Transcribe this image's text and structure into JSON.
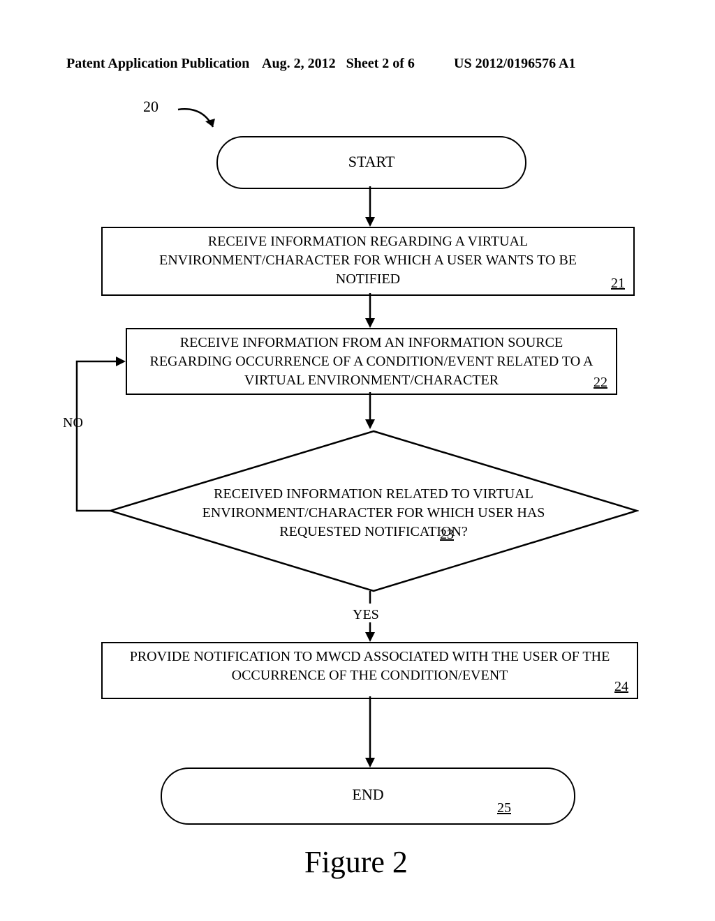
{
  "header": {
    "left": "Patent Application Publication",
    "mid_date": "Aug. 2, 2012",
    "mid_sheet": "Sheet 2 of 6",
    "right": "US 2012/0196576 A1"
  },
  "flowchart": {
    "ref_label": "20",
    "start": {
      "label": "START"
    },
    "step21": {
      "line1": "RECEIVE INFORMATION REGARDING A VIRTUAL",
      "line2": "ENVIRONMENT/CHARACTER FOR WHICH A USER WANTS TO BE",
      "line3": "NOTIFIED",
      "num": "21"
    },
    "step22": {
      "line1": "RECEIVE INFORMATION FROM AN INFORMATION SOURCE",
      "line2": "REGARDING OCCURRENCE OF A CONDITION/EVENT RELATED TO A",
      "line3": "VIRTUAL ENVIRONMENT/CHARACTER",
      "num": "22"
    },
    "decision23": {
      "line1": "RECEIVED INFORMATION RELATED TO VIRTUAL",
      "line2": "ENVIRONMENT/CHARACTER FOR WHICH USER HAS",
      "line3": "REQUESTED NOTIFICATION?",
      "num": "23",
      "no": "NO",
      "yes": "YES"
    },
    "step24": {
      "line1": "PROVIDE NOTIFICATION TO MWCD ASSOCIATED WITH THE USER OF THE",
      "line2": "OCCURRENCE OF THE CONDITION/EVENT",
      "num": "24"
    },
    "end": {
      "label": "END",
      "num": "25"
    },
    "caption": "Figure 2"
  }
}
